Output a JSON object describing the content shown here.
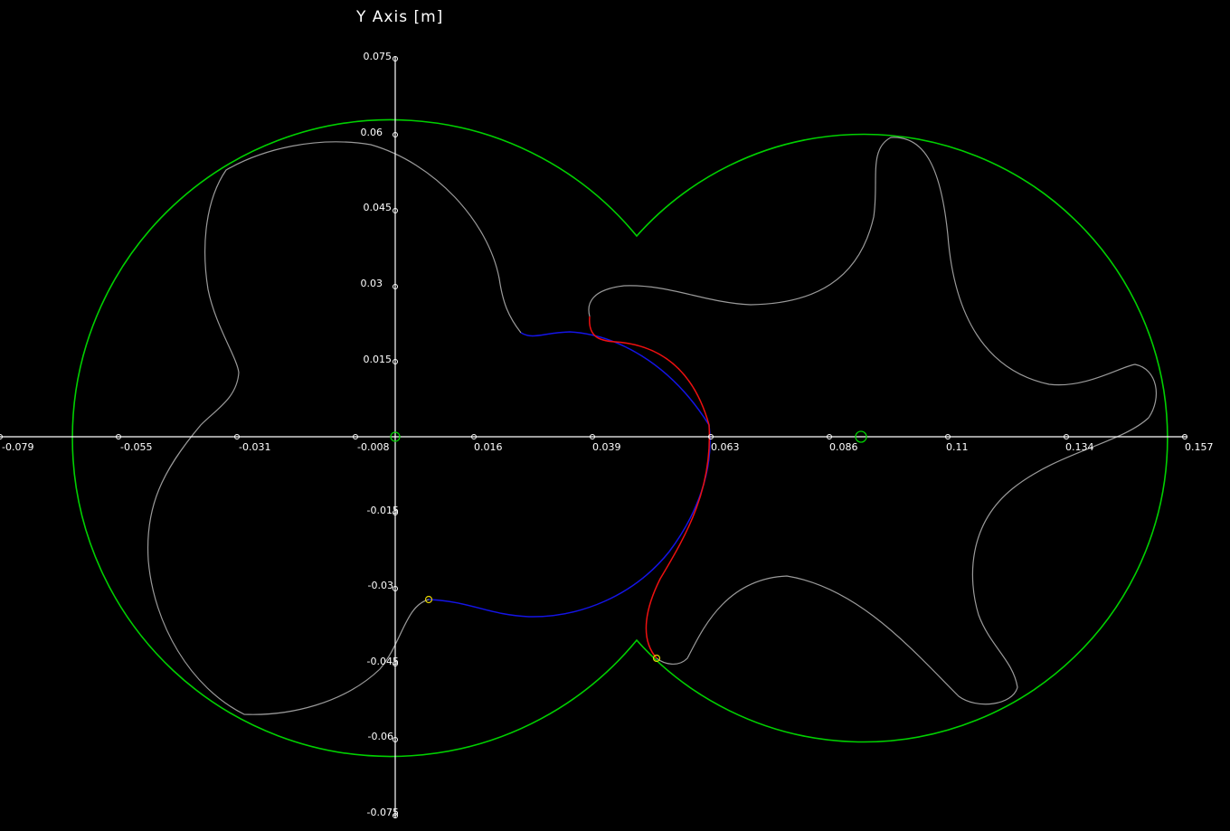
{
  "chart_data": {
    "type": "diagram",
    "ylabel": "Y Axis [m]",
    "x_ticks": [
      "-0.079",
      "-0.055",
      "-0.031",
      "-0.008",
      "0.016",
      "0.039",
      "0.063",
      "0.086",
      "0.11",
      "0.134",
      "0.157"
    ],
    "y_ticks": [
      "0.075",
      "0.06",
      "0.045",
      "0.03",
      "0.015",
      "-0.015",
      "-0.03",
      "-0.045",
      "-0.06",
      "-0.075"
    ],
    "xlim": [
      -0.079,
      0.157
    ],
    "ylim": [
      -0.075,
      0.075
    ],
    "colors": {
      "background": "#000000",
      "axes": "#ffffff",
      "housing": "#00d000",
      "rotor_profile": "#9a9a9a",
      "highlight_blue": "#1414e6",
      "highlight_red": "#ee1010",
      "markers": "#e0d000"
    },
    "series": [
      {
        "role": "housing-outline",
        "color": "#00d000"
      },
      {
        "role": "left-rotor-profile",
        "color": "#9a9a9a"
      },
      {
        "role": "right-rotor-profile",
        "color": "#9a9a9a"
      },
      {
        "role": "meshing-curve-left",
        "color": "#1414e6"
      },
      {
        "role": "meshing-curve-right",
        "color": "#ee1010"
      }
    ]
  }
}
